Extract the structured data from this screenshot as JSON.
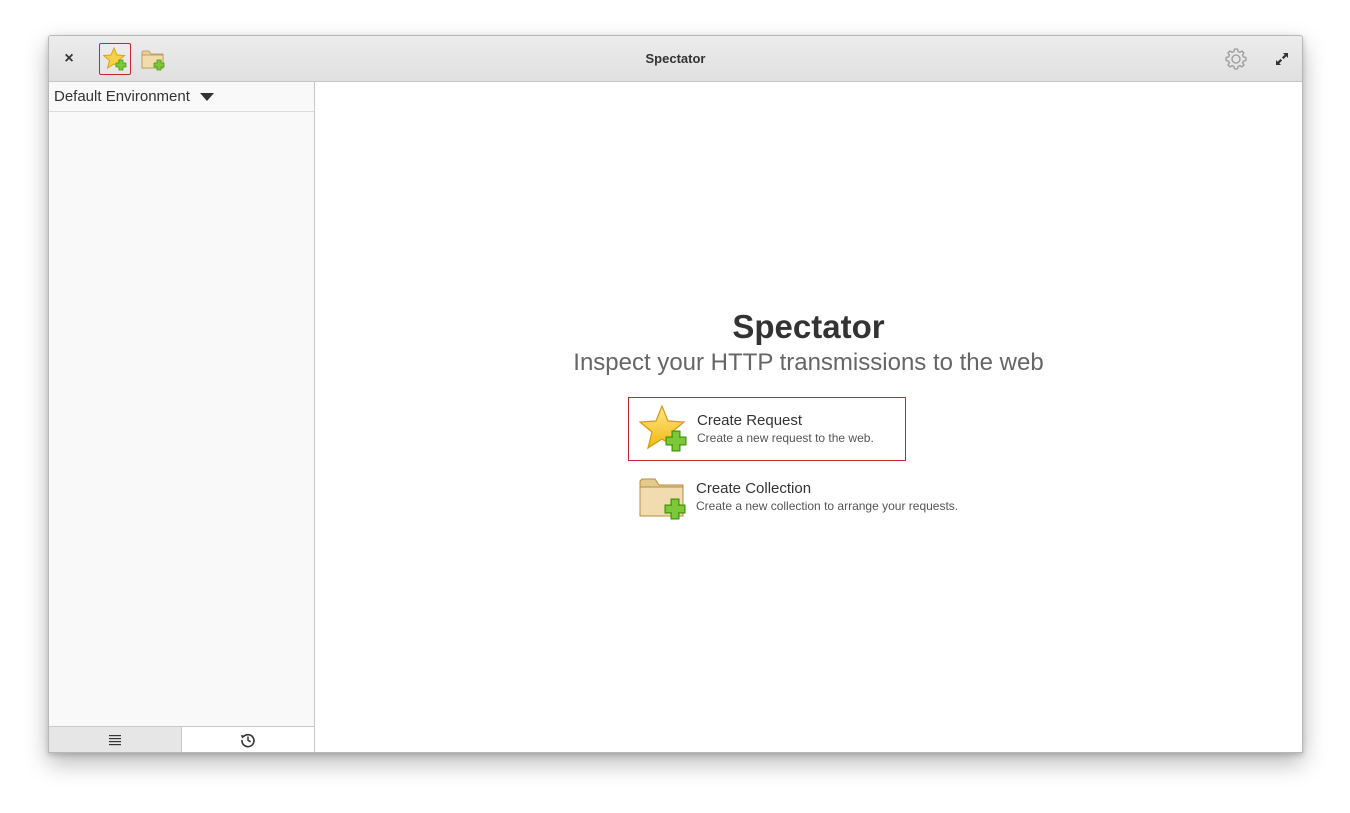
{
  "app": {
    "title": "Spectator"
  },
  "headerbar": {
    "close_glyph": "×",
    "buttons": [
      {
        "icon": "star-add-icon",
        "label": "Create Request",
        "active": true
      },
      {
        "icon": "folder-add-icon",
        "label": "Create Collection"
      },
      {
        "icon": "gear-icon",
        "label": "Settings"
      },
      {
        "icon": "fullscreen-icon",
        "label": "Fullscreen"
      }
    ]
  },
  "sidebar": {
    "environment": "Default Environment",
    "tabs": [
      {
        "icon": "list-icon",
        "active": true
      },
      {
        "icon": "history-icon",
        "active": false
      }
    ]
  },
  "welcome": {
    "title": "Spectator",
    "subtitle": "Inspect your HTTP transmissions to the web",
    "actions": [
      {
        "icon": "star-add-icon",
        "title": "Create Request",
        "description": "Create a new request to the web.",
        "focused": true
      },
      {
        "icon": "folder-add-icon",
        "title": "Create Collection",
        "description": "Create a new collection to arrange your requests."
      }
    ]
  },
  "colors": {
    "accent_focus": "#c6262e",
    "headerbar": "#e6e6e6",
    "sidebar_bg": "#f9f9f9",
    "star": "#f5c518",
    "plus": "#68b723",
    "folder": "#e8c98f"
  }
}
